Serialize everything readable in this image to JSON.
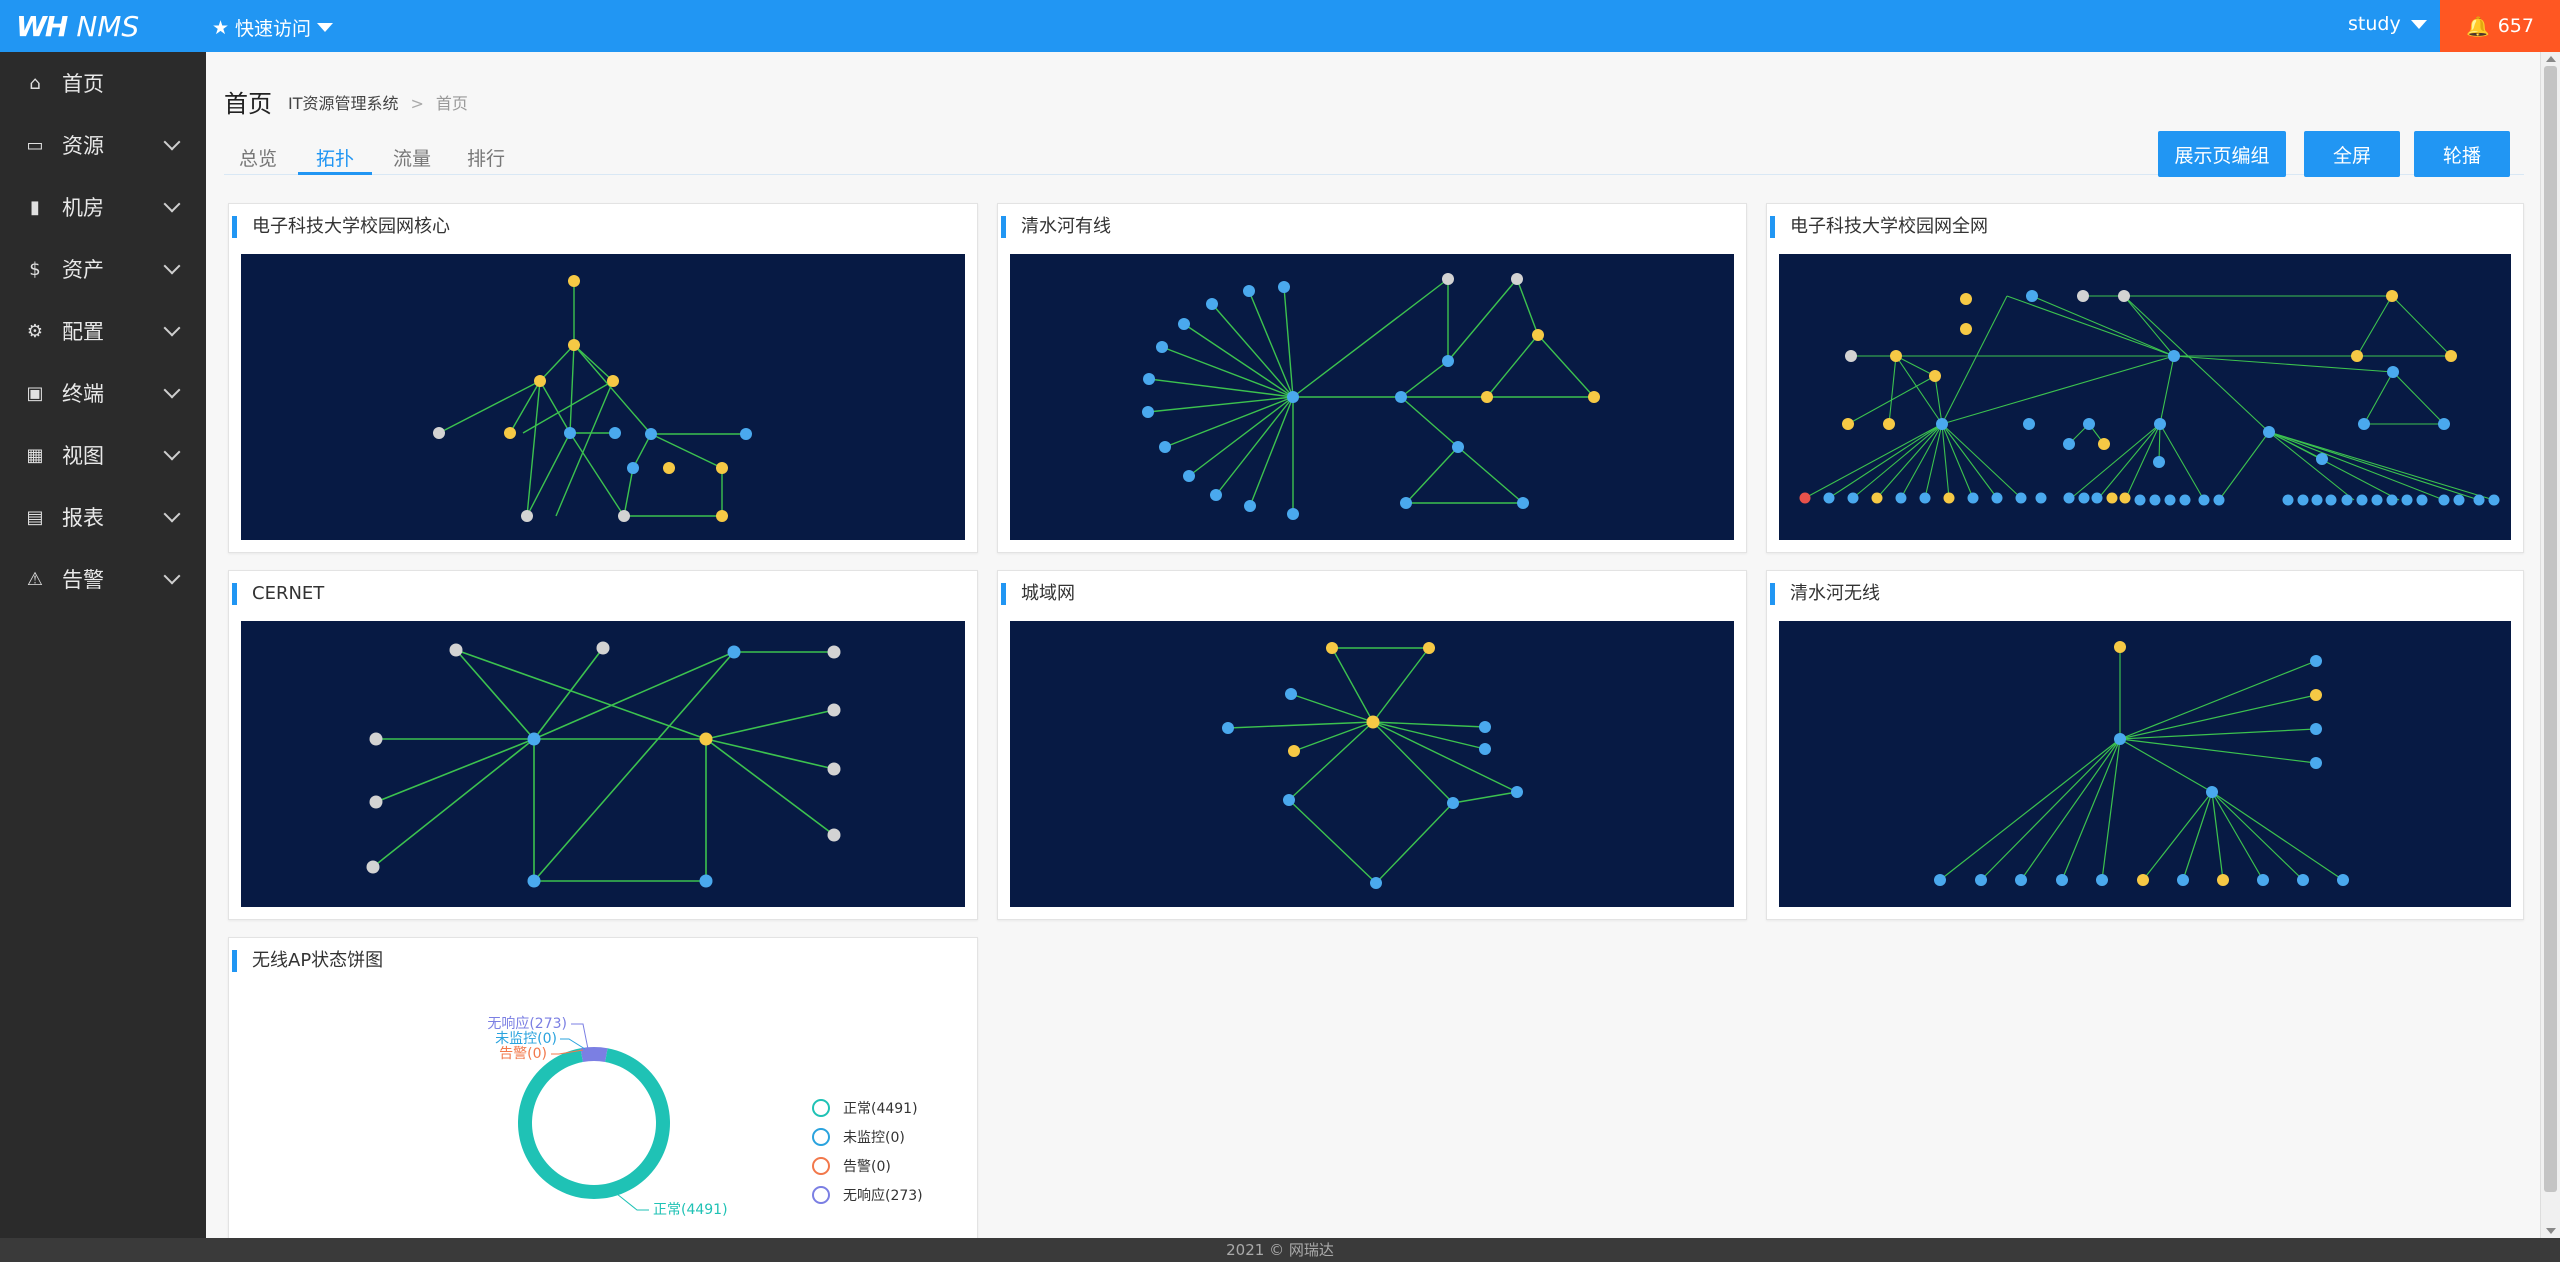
{
  "app": {
    "logo_mark": "WH",
    "logo_text": "NMS"
  },
  "topbar": {
    "quick_access": "快速访问",
    "user": "study",
    "alarm_count": "657"
  },
  "sidebar": {
    "items": [
      {
        "label": "首页",
        "icon": "home-icon"
      },
      {
        "label": "资源",
        "icon": "server-icon"
      },
      {
        "label": "机房",
        "icon": "building-icon"
      },
      {
        "label": "资产",
        "icon": "dollar-icon"
      },
      {
        "label": "配置",
        "icon": "gear-icon"
      },
      {
        "label": "终端",
        "icon": "monitor-icon"
      },
      {
        "label": "视图",
        "icon": "grid-icon"
      },
      {
        "label": "报表",
        "icon": "report-icon"
      },
      {
        "label": "告警",
        "icon": "warning-icon"
      }
    ]
  },
  "page": {
    "title": "首页",
    "breadcrumb_root": "IT资源管理系统",
    "breadcrumb_sep": ">",
    "breadcrumb_current": "首页"
  },
  "tabs": [
    "总览",
    "拓扑",
    "流量",
    "排行"
  ],
  "active_tab": "拓扑",
  "buttons": {
    "group_edit": "展示页编组",
    "fullscreen": "全屏",
    "carousel": "轮播"
  },
  "panels": [
    {
      "title": "电子科技大学校园网核心"
    },
    {
      "title": "清水河有线"
    },
    {
      "title": "电子科技大学校园网全网"
    },
    {
      "title": "CERNET"
    },
    {
      "title": "城域网"
    },
    {
      "title": "清水河无线"
    }
  ],
  "pie_panel": {
    "title": "无线AP状态饼图",
    "chart_data": {
      "type": "pie",
      "slices": [
        {
          "name": "正常",
          "value": 4491,
          "label": "正常(4491)",
          "color": "#1fc2b5"
        },
        {
          "name": "未监控",
          "value": 0,
          "label": "未监控(0)",
          "color": "#2aa3de"
        },
        {
          "name": "告警",
          "value": 0,
          "label": "告警(0)",
          "color": "#f2784b"
        },
        {
          "name": "无响应",
          "value": 273,
          "label": "无响应(273)",
          "color": "#7b7fe3"
        }
      ],
      "legend": [
        "正常(4491)",
        "未监控(0)",
        "告警(0)",
        "无响应(273)"
      ],
      "legend_position": "right"
    }
  },
  "colors": {
    "primary": "#2196f3",
    "alarm": "#ff5722",
    "topo_bg": "#071a44",
    "node_blue": "#4aa9ee",
    "node_yellow": "#f6c945",
    "node_gray": "#d3d3d3",
    "node_red": "#e8524b",
    "link": "#3cc24f"
  },
  "footer": "2021 © 网瑞达"
}
